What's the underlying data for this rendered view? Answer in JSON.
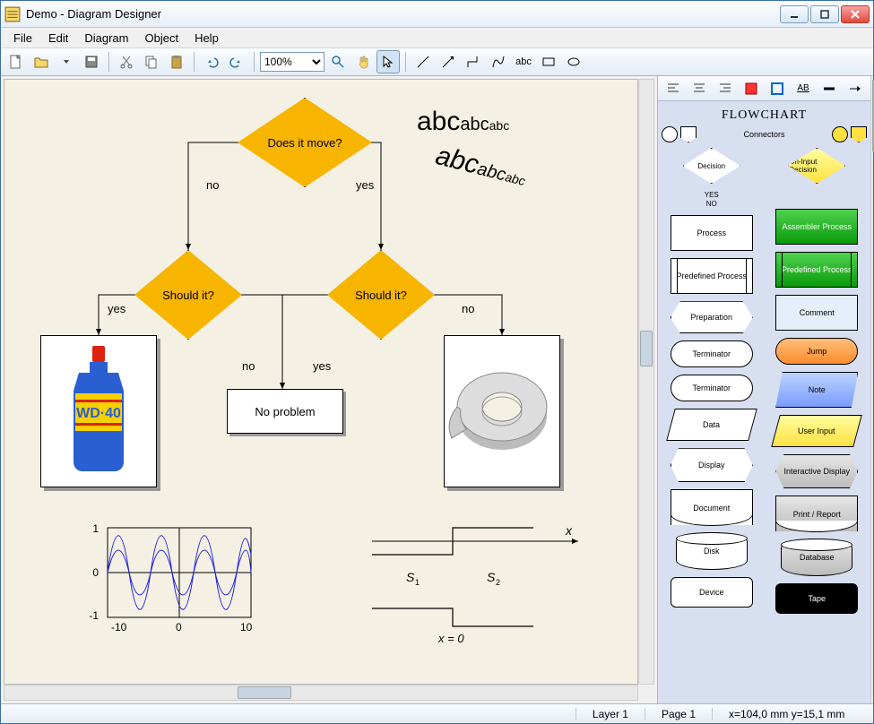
{
  "window": {
    "title": "Demo - Diagram Designer"
  },
  "menu": {
    "file": "File",
    "edit": "Edit",
    "diagram": "Diagram",
    "object": "Object",
    "help": "Help"
  },
  "toolbar": {
    "zoom": "100%"
  },
  "palette": {
    "title": "FLOWCHART",
    "connectors_label": "Connectors",
    "yes": "YES",
    "no": "NO",
    "decision": "Decision",
    "on_input_decision": "On-Input Decision",
    "process": "Process",
    "assembler_process": "Assembler Process",
    "predefined_process": "Predefined Process",
    "predefined_process2": "Predefined Process",
    "preparation": "Preparation",
    "comment": "Comment",
    "terminator": "Terminator",
    "jump": "Jump",
    "terminator2": "Terminator",
    "note": "Note",
    "data": "Data",
    "user_input": "User Input",
    "display": "Display",
    "interactive_display": "Interactive Display",
    "document": "Document",
    "print_report": "Print / Report",
    "disk": "Disk",
    "database": "Database",
    "device": "Device",
    "tape": "Tape"
  },
  "flowchart": {
    "q1": "Does it move?",
    "q2": "Should it?",
    "q3": "Should it?",
    "noproblem": "No problem",
    "yes": "yes",
    "no": "no"
  },
  "demo_text": {
    "abc1": "abc",
    "abc2": "abc",
    "abc3": "abc"
  },
  "waveform": {
    "y_ticks": [
      "1",
      "0",
      "-1"
    ],
    "x_ticks": [
      "-10",
      "0",
      "10"
    ]
  },
  "sig": {
    "s1": "S",
    "s1sub": "1",
    "s2": "S",
    "s2sub": "2",
    "x": "x",
    "x0": "x = 0"
  },
  "status": {
    "layer": "Layer 1",
    "page": "Page 1",
    "coords": "x=104,0 mm  y=15,1 mm"
  }
}
